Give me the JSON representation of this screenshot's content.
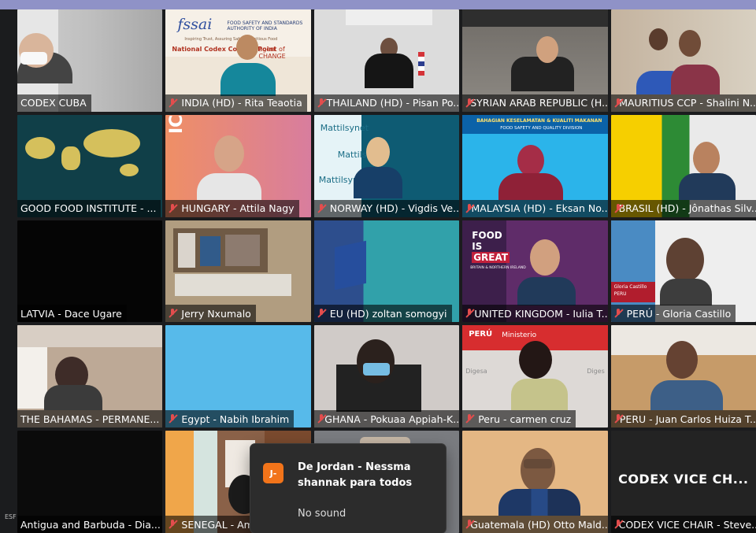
{
  "side_label": "ESF",
  "participants": [
    {
      "name": "CODEX CUBA",
      "muted": false,
      "bg": "#b8b6b5"
    },
    {
      "name": "INDIA (HD) - Rita Teaotia",
      "muted": true,
      "bg": "#e7ddd0"
    },
    {
      "name": "THAILAND (HD) - Pisan Po...",
      "muted": true,
      "bg": "#d9d7d7"
    },
    {
      "name": "SYRIAN ARAB REPUBLIC (H...",
      "muted": true,
      "bg": "#8d8a84"
    },
    {
      "name": "MAURITIUS CCP - Shalini N...",
      "muted": true,
      "bg": "#c8b9a7"
    },
    {
      "name": "GOOD FOOD INSTITUTE - ...",
      "muted": false,
      "bg": "#16434c"
    },
    {
      "name": "HUNGARY - Attila Nagy",
      "muted": true,
      "bg": "#e58c68"
    },
    {
      "name": "NORWAY (HD) -  Vigdis Ve...",
      "muted": true,
      "bg": "#0f5d74"
    },
    {
      "name": "MALAYSIA (HD) - Eksan No...",
      "muted": true,
      "bg": "#2fb8e6"
    },
    {
      "name": "BRASIL (HD) - Jônathas Silv...",
      "muted": true,
      "bg": "#8bb07b"
    },
    {
      "name": "LATVIA - Dace Ugare",
      "muted": false,
      "bg": "#050505"
    },
    {
      "name": "Jerry Nxumalo",
      "muted": true,
      "bg": "#9b8a73"
    },
    {
      "name": "EU (HD) zoltan somogyi",
      "muted": true,
      "bg": "#2f8a9b"
    },
    {
      "name": "UNITED KINGDOM - Iulia T...",
      "muted": true,
      "bg": "#612f6e"
    },
    {
      "name": "PERÚ - Gloria Castillo",
      "muted": true,
      "bg": "#f0f0f0"
    },
    {
      "name": "THE BAHAMAS - PERMANE...",
      "muted": false,
      "bg": "#b9aca0"
    },
    {
      "name": "Egypt - Nabih Ibrahim",
      "muted": true,
      "bg": "#56b9e9"
    },
    {
      "name": "GHANA - Pokuaa Appiah-K...",
      "muted": true,
      "bg": "#cbc7c4"
    },
    {
      "name": "Peru - carmen cruz",
      "muted": true,
      "bg": "#dedad8"
    },
    {
      "name": "PERU - Juan Carlos Huiza T...",
      "muted": true,
      "bg": "#c79a67"
    },
    {
      "name": "Antigua and Barbuda - Dia...",
      "muted": false,
      "bg": "#0b0b0b"
    },
    {
      "name": "SENEGAL - Amad",
      "muted": true,
      "bg": "#7c4a2c"
    },
    {
      "name": "",
      "muted": false,
      "bg": "#7a7c80"
    },
    {
      "name": "Guatemala (HD) Otto Mald...",
      "muted": true,
      "bg": "#e1b783"
    },
    {
      "name": "CODEX VICE CHAIR - Steve...",
      "muted": true,
      "bg": "#232323"
    }
  ],
  "tile_texts": {
    "fssai_logo": "fssai",
    "fssai_line1": "FOOD SAFETY AND STANDARDS",
    "fssai_line2": "AUTHORITY OF INDIA",
    "fssai_line3": "Inspiring Trust, Assuring Safe & Nutritious Food",
    "fssai_line4": "National Codex Contact Point",
    "fssai_line5": "agent of CHANGE",
    "hungary_text": "ICMAS",
    "mattilsynet_1": "Mattilsynet",
    "mattilsynet_2": "Mattils",
    "mattilsynet_3": "Mattilsyn",
    "malaysia_title_1": "BAHAGIAN KESELAMATAN & KUALITI MAKANAN",
    "malaysia_title_2": "FOOD SAFETY AND QUALITY DIVISION",
    "uk_1": "FOOD",
    "uk_2": "IS",
    "uk_3": "GREAT",
    "uk_4": "BRITAIN & NORTHERN IRELAND",
    "peru_gloria_1": "Gloria Castillo",
    "peru_gloria_2": "PERU",
    "peru_carmen_1": "PERÚ",
    "peru_carmen_2": "Ministerio",
    "peru_carmen_3": "Digesa",
    "peru_carmen_4": "Diges",
    "codex_vice": "CODEX VICE CH..."
  },
  "chat_popup": {
    "avatar": "J-",
    "from": "De Jordan - Nessma shannak para todos",
    "message": "No sound"
  },
  "colors": {
    "muted_icon": "#e34d4d",
    "top_bar": "#8f92c7",
    "chat_avatar": "#f2741a"
  }
}
